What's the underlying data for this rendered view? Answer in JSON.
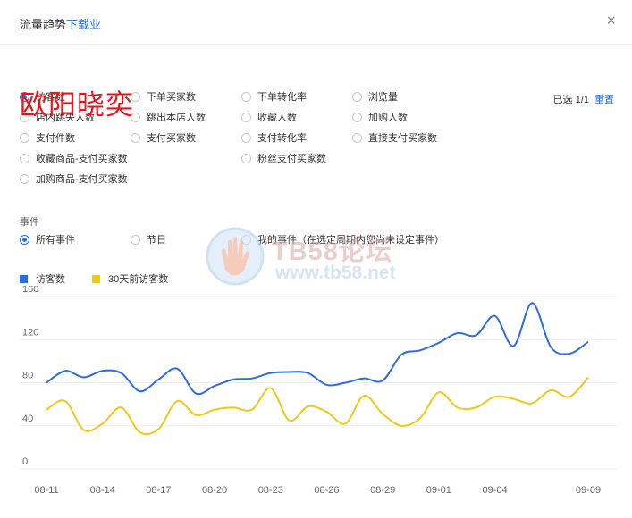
{
  "header": {
    "title": "流量趋势",
    "link": "下载业",
    "close_label": "×"
  },
  "watermark_name": "欧阳晓奕",
  "metrics": {
    "selected_prefix": "已选 1/1",
    "reset_label": "重置",
    "items": [
      {
        "label": "访客数",
        "checked": true
      },
      {
        "label": "下单买家数",
        "checked": false
      },
      {
        "label": "下单转化率",
        "checked": false
      },
      {
        "label": "浏览量",
        "checked": false
      },
      {
        "label": "店内跳失人数",
        "checked": false
      },
      {
        "label": "跳出本店人数",
        "checked": false
      },
      {
        "label": "收藏人数",
        "checked": false
      },
      {
        "label": "加购人数",
        "checked": false
      },
      {
        "label": "支付件数",
        "checked": false
      },
      {
        "label": "支付买家数",
        "checked": false
      },
      {
        "label": "支付转化率",
        "checked": false
      },
      {
        "label": "直接支付买家数",
        "checked": false
      },
      {
        "label": "收藏商品-支付买家数",
        "checked": false
      },
      {
        "label": "粉丝支付买家数",
        "checked": false
      },
      {
        "label": "加购商品-支付买家数",
        "checked": false
      }
    ]
  },
  "events": {
    "title": "事件",
    "options": [
      {
        "label": "所有事件",
        "checked": true
      },
      {
        "label": "节日",
        "checked": false
      },
      {
        "label": "我的事件（在选定周期内您尚未设定事件）",
        "checked": false
      }
    ]
  },
  "logo": {
    "text": "TB58论坛",
    "url_text": "www.tb58.net"
  },
  "colors": {
    "accent": "#2b6fe0",
    "series_current": "#2f6be0",
    "series_previous": "#f0c818",
    "grid": "#ececec"
  },
  "chart_data": {
    "type": "line",
    "x": [
      "08-11",
      "08-12",
      "08-13",
      "08-14",
      "08-15",
      "08-16",
      "08-17",
      "08-18",
      "08-19",
      "08-20",
      "08-21",
      "08-22",
      "08-23",
      "08-24",
      "08-25",
      "08-26",
      "08-27",
      "08-28",
      "08-29",
      "08-30",
      "08-31",
      "09-01",
      "09-02",
      "09-03",
      "09-04",
      "09-05",
      "09-06",
      "09-07",
      "09-08",
      "09-09"
    ],
    "tick_labels": [
      "08-11",
      "08-14",
      "08-17",
      "08-20",
      "08-23",
      "08-26",
      "08-29",
      "09-01",
      "09-04",
      "09-09"
    ],
    "tick_indices": [
      0,
      3,
      6,
      9,
      12,
      15,
      18,
      21,
      24,
      29
    ],
    "ylim": [
      0,
      160
    ],
    "yticks": [
      0,
      40,
      80,
      120,
      160
    ],
    "grid": true,
    "legend": "top-left",
    "series": [
      {
        "name": "访客数",
        "values": [
          80,
          91,
          85,
          91,
          89,
          72,
          83,
          93,
          70,
          77,
          83,
          84,
          89,
          90,
          89,
          78,
          80,
          84,
          82,
          106,
          110,
          117,
          126,
          124,
          142,
          114,
          154,
          113,
          107,
          118
        ]
      },
      {
        "name": "30天前访客数",
        "values": [
          55,
          63,
          36,
          42,
          57,
          34,
          37,
          63,
          50,
          55,
          57,
          55,
          75,
          45,
          58,
          53,
          42,
          68,
          51,
          40,
          47,
          71,
          57,
          57,
          67,
          65,
          61,
          73,
          67,
          85
        ]
      }
    ]
  }
}
